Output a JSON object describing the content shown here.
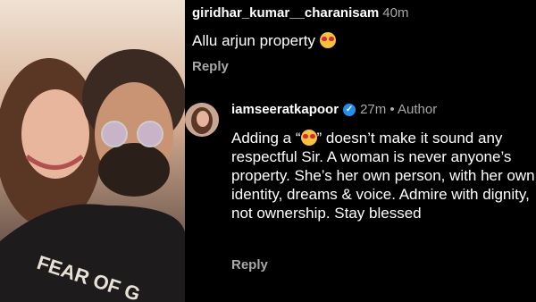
{
  "comment1": {
    "username": "giridhar_kumar__charanisam",
    "time": "40m",
    "text": "Allu arjun property",
    "reply": "Reply"
  },
  "comment2": {
    "username": "iamseeratkapoor",
    "meta": "27m • Author",
    "text_pre": "Adding a “",
    "text_post": "” doesn’t make it sound any respectful Sir. A woman is never anyone’s property. She’s her own person, with her own identity, dreams & voice. Admire with dignity, not ownership. Stay blessed",
    "reply": "Reply"
  },
  "photo": {
    "shirt_text": "FEAR OF G"
  },
  "colors": {
    "background": "#000000",
    "muted": "#a8a8a8",
    "verified": "#1f8ff0"
  },
  "icons": [
    "heart-eyes-emoji-icon",
    "verified-badge-icon"
  ]
}
